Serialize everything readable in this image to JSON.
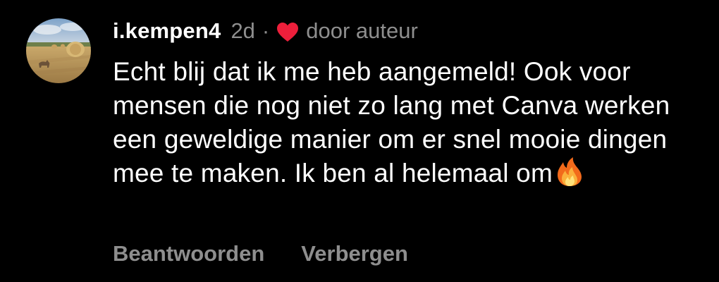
{
  "comment": {
    "username": "i.kempen4",
    "time": "2d",
    "separator": "·",
    "liked_by_author_label": "door auteur",
    "text_main": "Echt blij dat ik me heb aangemeld! Ook voor mensen die nog niet zo lang met Canva werken een geweldige manier om er snel mooie dingen mee te maken. Ik ben al helemaal om",
    "text_emoji_icon": "fire-icon",
    "heart_color": "#ed1f3b",
    "avatar_icon": "landscape-hay-bales-avatar"
  },
  "actions": {
    "reply_label": "Beantwoorden",
    "hide_label": "Verbergen"
  }
}
